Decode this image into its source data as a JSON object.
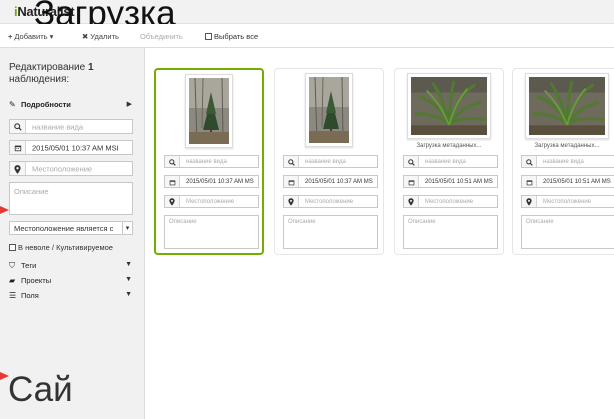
{
  "app": {
    "logo_prefix": "i",
    "logo_name": "Naturalist"
  },
  "overlay": {
    "title": "Загрузка",
    "bottom": "Сай"
  },
  "toolbar": {
    "add_icon": "+",
    "add_label": "Добавить",
    "add_caret": "▾",
    "delete_icon": "✖",
    "delete_label": "Удалить",
    "combine_label": "Объединить",
    "select_all_label": "Выбрать все"
  },
  "sidebar": {
    "heading_prefix": "Редактирование",
    "heading_count": "1",
    "heading_suffix": "наблюдения:",
    "details_label": "Подробности",
    "species_placeholder": "название вида",
    "date_value": "2015/05/01 10:37 AM MSI",
    "location_placeholder": "Местоположение",
    "description_placeholder": "Описание",
    "geoprivacy_value": "Местоположение является с",
    "captive_label": "В неволе / Культивируемое",
    "tags_label": "Теги",
    "projects_label": "Проекты",
    "fields_label": "Поля",
    "icons": {
      "details": "pencil-icon",
      "species": "search-icon",
      "date": "calendar-icon",
      "location": "map-marker-icon",
      "tags": "tag-icon",
      "projects": "briefcase-icon",
      "fields": "list-icon"
    }
  },
  "cards": [
    {
      "caption": "",
      "species_placeholder": "название вида",
      "date_value": "2015/05/01 10:37 AM MS",
      "location_placeholder": "Местоположение",
      "description_placeholder": "Описание",
      "selected": true
    },
    {
      "caption": "",
      "species_placeholder": "название вида",
      "date_value": "2015/05/01 10:37 AM MS",
      "location_placeholder": "Местоположение",
      "description_placeholder": "Описание",
      "selected": false
    },
    {
      "caption": "Загрузка метаданных...",
      "species_placeholder": "название вида",
      "date_value": "2015/05/01 10:51 AM MS",
      "location_placeholder": "Местоположение",
      "description_placeholder": "Описание",
      "selected": false
    },
    {
      "caption": "Загрузка метаданных...",
      "species_placeholder": "название вида",
      "date_value": "2015/05/01 10:51 AM MS",
      "location_placeholder": "Местоположение",
      "description_placeholder": "Описание",
      "selected": false
    }
  ],
  "colors": {
    "accent": "#74ac00",
    "marker": "#e53935",
    "sidebar_bg": "#f1f1f1"
  }
}
